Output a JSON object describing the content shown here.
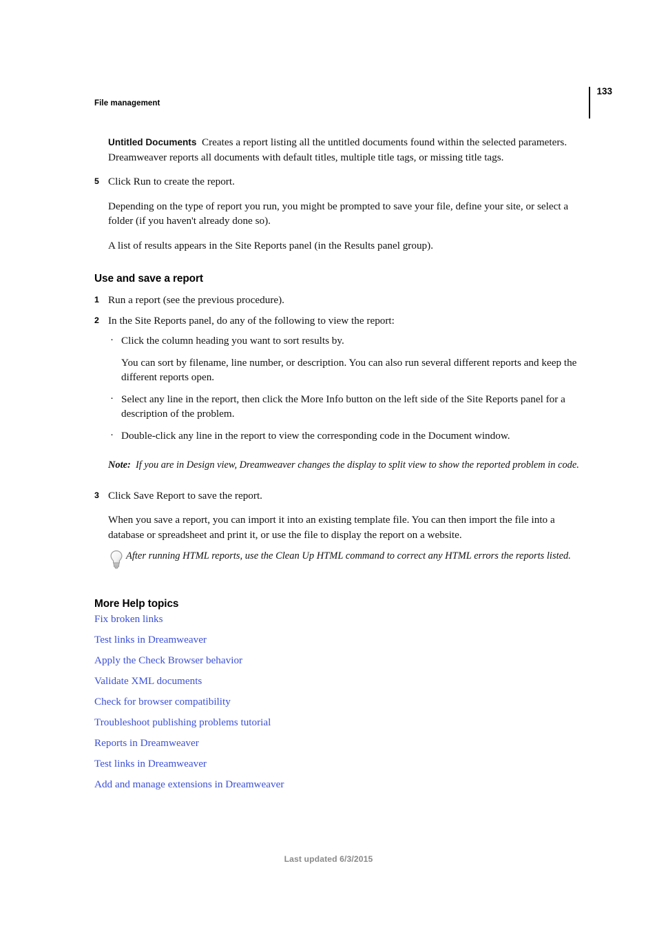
{
  "header": {
    "running_head": "File management",
    "page_number": "133"
  },
  "body": {
    "untitled_docs_term": "Untitled Documents",
    "untitled_docs_desc": "Creates a report listing all the untitled documents found within the selected parameters. Dreamweaver reports all documents with default titles, multiple title tags, or missing title tags.",
    "step5_num": "5",
    "step5_text": "Click Run to create the report.",
    "step5_para1": "Depending on the type of report you run, you might be prompted to save your file, define your site, or select a folder (if you haven't already done so).",
    "step5_para2": "A list of results appears in the Site Reports panel (in the Results panel group)."
  },
  "section_use_save": {
    "heading": "Use and save a report",
    "step1_num": "1",
    "step1_text": "Run a report (see the previous procedure).",
    "step2_num": "2",
    "step2_text": "In the Site Reports panel, do any of the following to view the report:",
    "bullet_marker": "·",
    "bullet1_text": "Click the column heading you want to sort results by.",
    "bullet1_para": "You can sort by filename, line number, or description. You can also run several different reports and keep the different reports open.",
    "bullet2_text": "Select any line in the report, then click the More Info button on the left side of the Site Reports panel for a description of the problem.",
    "bullet3_text": "Double-click any line in the report to view the corresponding code in the Document window.",
    "note_label": "Note:",
    "note_text": "If you are in Design view, Dreamweaver changes the display to split view to show the reported problem in code.",
    "step3_num": "3",
    "step3_text": "Click Save Report to save the report.",
    "step3_para": "When you save a report, you can import it into an existing template file. You can then import the file into a database or spreadsheet and print it, or use the file to display the report on a website.",
    "tip_text": "After running HTML reports, use the Clean Up HTML command to correct any HTML errors the reports listed."
  },
  "more_help": {
    "heading": "More Help topics",
    "links": [
      "Fix broken links",
      "Test links in Dreamweaver",
      "Apply the Check Browser behavior",
      "Validate XML documents",
      "Check for browser compatibility",
      "Troubleshoot publishing problems tutorial",
      "Reports in Dreamweaver",
      "Test links in Dreamweaver",
      "Add and manage extensions in Dreamweaver"
    ]
  },
  "footer": {
    "text": "Last updated 6/3/2015"
  },
  "colors": {
    "link": "#3a4fd6",
    "footer": "#8a8a8a",
    "text": "#111111"
  }
}
